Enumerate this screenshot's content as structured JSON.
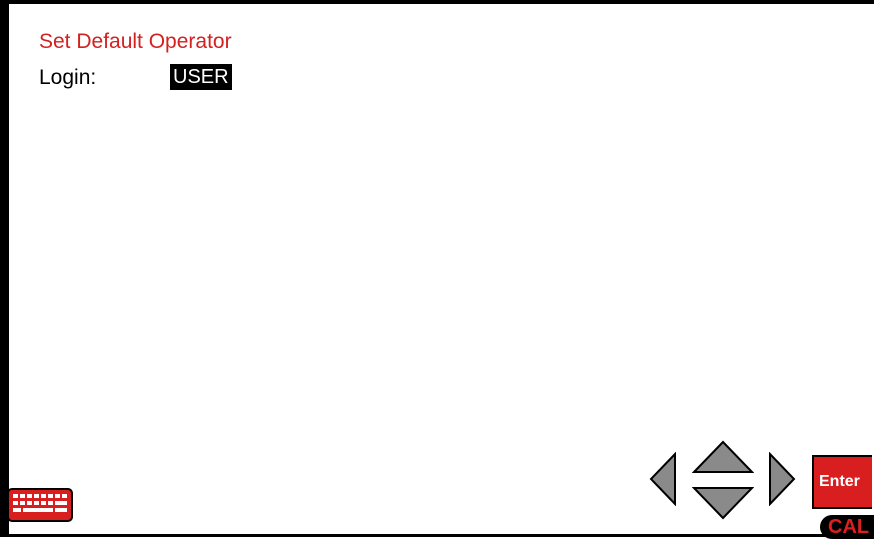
{
  "screen": {
    "title": "Set Default Operator",
    "login_label": "Login:",
    "login_value": "USER"
  },
  "controls": {
    "keyboard_icon": "keyboard-icon",
    "arrows": [
      "arrow-left-icon",
      "arrow-up-icon",
      "arrow-down-icon",
      "arrow-right-icon"
    ],
    "enter_label": "Enter",
    "cal_label": "CAL"
  },
  "colors": {
    "title_red": "#d42020",
    "button_red": "#d81e1e",
    "arrow_gray": "#8a8a8a",
    "highlight_bg": "#000000"
  }
}
